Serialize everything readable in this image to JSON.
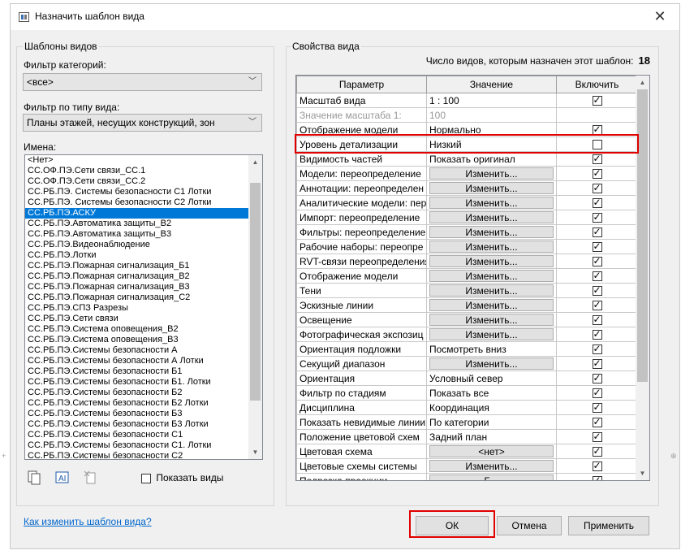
{
  "window": {
    "title": "Назначить шаблон вида",
    "close_glyph": "✕"
  },
  "templates": {
    "group_label": "Шаблоны видов",
    "category_filter_label": "Фильтр категорий:",
    "category_filter_value": "<все>",
    "viewtype_filter_label": "Фильтр по типу вида:",
    "viewtype_filter_value": "Планы этажей, несущих конструкций, зон",
    "names_label": "Имена:",
    "names": [
      "<Нет>",
      "СС.ОФ.ПЭ.Сети связи_СС.1",
      "СС.ОФ.ПЭ.Сети связи_СС.2",
      "СС.РБ.ПЭ. Системы безопасности С1 Лотки",
      "СС.РБ.ПЭ. Системы безопасности С2 Лотки",
      "СС.РБ.ПЭ.АСКУ",
      "СС.РБ.ПЭ.Автоматика защиты_В2",
      "СС.РБ.ПЭ.Автоматика защиты_В3",
      "СС.РБ.ПЭ.Видеонаблюдение",
      "СС.РБ.ПЭ.Лотки",
      "СС.РБ.ПЭ.Пожарная сигнализация_Б1",
      "СС.РБ.ПЭ.Пожарная сигнализация_В2",
      "СС.РБ.ПЭ.Пожарная сигнализация_В3",
      "СС.РБ.ПЭ.Пожарная сигнализация_С2",
      "СС.РБ.ПЭ.СПЗ Разрезы",
      "СС.РБ.ПЭ.Сети связи",
      "СС.РБ.ПЭ.Система оповещения_В2",
      "СС.РБ.ПЭ.Система оповещения_В3",
      "СС.РБ.ПЭ.Системы безопасности А",
      "СС.РБ.ПЭ.Системы безопасности А Лотки",
      "СС.РБ.ПЭ.Системы безопасности Б1",
      "СС.РБ.ПЭ.Системы безопасности Б1. Лотки",
      "СС.РБ.ПЭ.Системы безопасности Б2",
      "СС.РБ.ПЭ.Системы безопасности Б2 Лотки",
      "СС.РБ.ПЭ.Системы безопасности Б3",
      "СС.РБ.ПЭ.Системы безопасности Б3 Лотки",
      "СС.РБ.ПЭ.Системы безопасности С1",
      "СС.РБ.ПЭ.Системы безопасности С1. Лотки",
      "СС.РБ.ПЭ.Системы безопасности С2"
    ],
    "selected_name": "СС.РБ.ПЭ.АСКУ",
    "show_views_label": "Показать виды",
    "show_views_checked": false
  },
  "properties": {
    "group_label": "Свойства вида",
    "count_label": "Число видов, которым назначен этот шаблон:",
    "count_value": "18",
    "headers": {
      "param": "Параметр",
      "value": "Значение",
      "include": "Включить"
    },
    "rows": [
      {
        "param": "Масштаб вида",
        "value": "1 : 100",
        "button": false,
        "include": true
      },
      {
        "param": "Значение масштаба    1:",
        "value": "100",
        "button": false,
        "include": null,
        "grey": true
      },
      {
        "param": "Отображение модели",
        "value": "Нормально",
        "button": false,
        "include": true
      },
      {
        "param": "Уровень детализации",
        "value": "Низкий",
        "button": false,
        "include": false
      },
      {
        "param": "Видимость частей",
        "value": "Показать оригинал",
        "button": false,
        "include": true
      },
      {
        "param": "Модели: переопределение",
        "value": "Изменить...",
        "button": true,
        "include": true
      },
      {
        "param": "Аннотации: переопределен",
        "value": "Изменить...",
        "button": true,
        "include": true
      },
      {
        "param": "Аналитические модели: пер",
        "value": "Изменить...",
        "button": true,
        "include": true
      },
      {
        "param": "Импорт: переопределение",
        "value": "Изменить...",
        "button": true,
        "include": true
      },
      {
        "param": "Фильтры: переопределение",
        "value": "Изменить...",
        "button": true,
        "include": true
      },
      {
        "param": "Рабочие наборы: переопре",
        "value": "Изменить...",
        "button": true,
        "include": true
      },
      {
        "param": "RVT-связи переопределения",
        "value": "Изменить...",
        "button": true,
        "include": true
      },
      {
        "param": "Отображение модели",
        "value": "Изменить...",
        "button": true,
        "include": true
      },
      {
        "param": "Тени",
        "value": "Изменить...",
        "button": true,
        "include": true
      },
      {
        "param": "Эскизные линии",
        "value": "Изменить...",
        "button": true,
        "include": true
      },
      {
        "param": "Освещение",
        "value": "Изменить...",
        "button": true,
        "include": true
      },
      {
        "param": "Фотографическая экспозиц",
        "value": "Изменить...",
        "button": true,
        "include": true
      },
      {
        "param": "Ориентация подложки",
        "value": "Посмотреть вниз",
        "button": false,
        "include": true
      },
      {
        "param": "Секущий диапазон",
        "value": "Изменить...",
        "button": true,
        "include": true
      },
      {
        "param": "Ориентация",
        "value": "Условный север",
        "button": false,
        "include": true
      },
      {
        "param": "Фильтр по стадиям",
        "value": "Показать все",
        "button": false,
        "include": true
      },
      {
        "param": "Дисциплина",
        "value": "Координация",
        "button": false,
        "include": true
      },
      {
        "param": "Показать невидимые линии",
        "value": "По категории",
        "button": false,
        "include": true
      },
      {
        "param": "Положение цветовой схем",
        "value": "Задний план",
        "button": false,
        "include": true
      },
      {
        "param": "Цветовая схема",
        "value": "<нет>",
        "button": true,
        "include": true
      },
      {
        "param": "Цветовые схемы системы",
        "value": "Изменить...",
        "button": true,
        "include": true
      },
      {
        "param": "Подрезка проекции",
        "value": "Б...",
        "button": true,
        "include": true
      }
    ]
  },
  "footer": {
    "help_link": "Как изменить шаблон вида?",
    "ok": "ОК",
    "cancel": "Отмена",
    "apply": "Применить"
  },
  "colors": {
    "highlight": "#e00000",
    "selection": "#0078d7",
    "link": "#0066cc"
  }
}
